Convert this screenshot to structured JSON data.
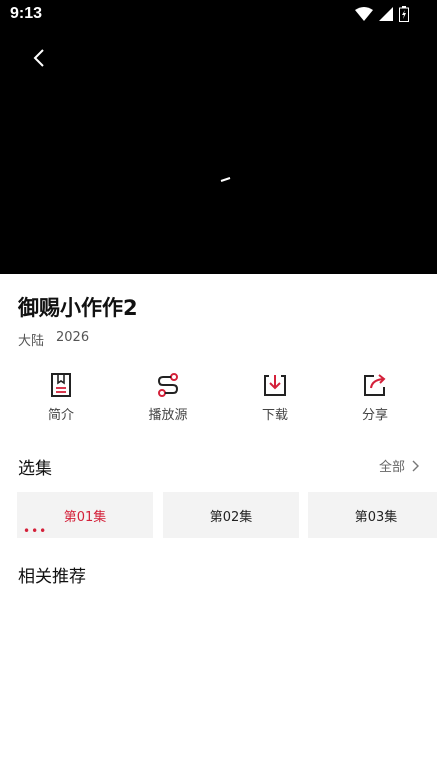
{
  "status": {
    "time": "9:13"
  },
  "player": {
    "back_icon": "chevron-left-icon",
    "loading_icon": "spinner-icon"
  },
  "show": {
    "title": "御赐小作作2",
    "region": "大陆",
    "year": "2026"
  },
  "actions": [
    {
      "label": "简介",
      "icon": "bookmark-doc-icon"
    },
    {
      "label": "播放源",
      "icon": "route-icon"
    },
    {
      "label": "下载",
      "icon": "download-icon"
    },
    {
      "label": "分享",
      "icon": "share-icon"
    }
  ],
  "episodes_section": {
    "title": "选集",
    "all_label": "全部"
  },
  "episodes": [
    {
      "label": "第01集",
      "active": true
    },
    {
      "label": "第02集",
      "active": false
    },
    {
      "label": "第03集",
      "active": false
    }
  ],
  "related": {
    "title": "相关推荐"
  },
  "colors": {
    "accent": "#d4213a",
    "player_bg": "#000000",
    "chip_bg": "#f3f3f3"
  }
}
